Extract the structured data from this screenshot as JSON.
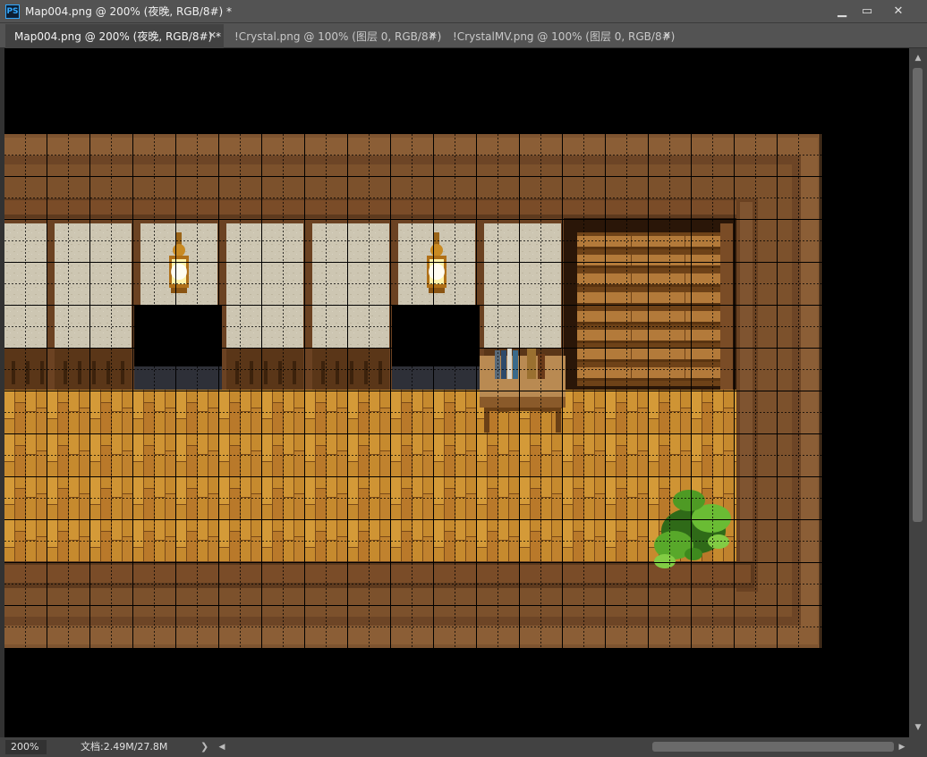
{
  "window": {
    "app_icon": "PS",
    "title": "Map004.png @ 200% (夜晚, RGB/8#) *",
    "minimize_glyph": "▁",
    "maximize_glyph": "▭",
    "close_glyph": "✕"
  },
  "tabs": [
    {
      "label": "Map004.png @ 200% (夜晚, RGB/8#) *",
      "close": "✕",
      "active": true
    },
    {
      "label": "!Crystal.png @ 100% (图层 0, RGB/8#)",
      "close": "✕",
      "active": false
    },
    {
      "label": "!CrystalMV.png @ 100% (图层 0, RGB/8#)",
      "close": "✕",
      "active": false
    }
  ],
  "statusbar": {
    "zoom": "200%",
    "doc_info": "文档:2.49M/27.8M",
    "expand_glyph": "❯"
  },
  "scrollbars": {
    "vertical": {
      "up": "▲",
      "down": "▼"
    },
    "horizontal": {
      "left": "◀",
      "right": "▶"
    }
  },
  "canvas": {
    "background": "#000000",
    "wood_floor": "#c68a2e",
    "wood_floor_dark": "#9c6420",
    "wall_frame": "#7a4e2a",
    "wall_panel": "#cfc8b4",
    "lamp_glow": "#fff2a8",
    "plant_green": "#58a82a",
    "grid_color": "#000000"
  }
}
